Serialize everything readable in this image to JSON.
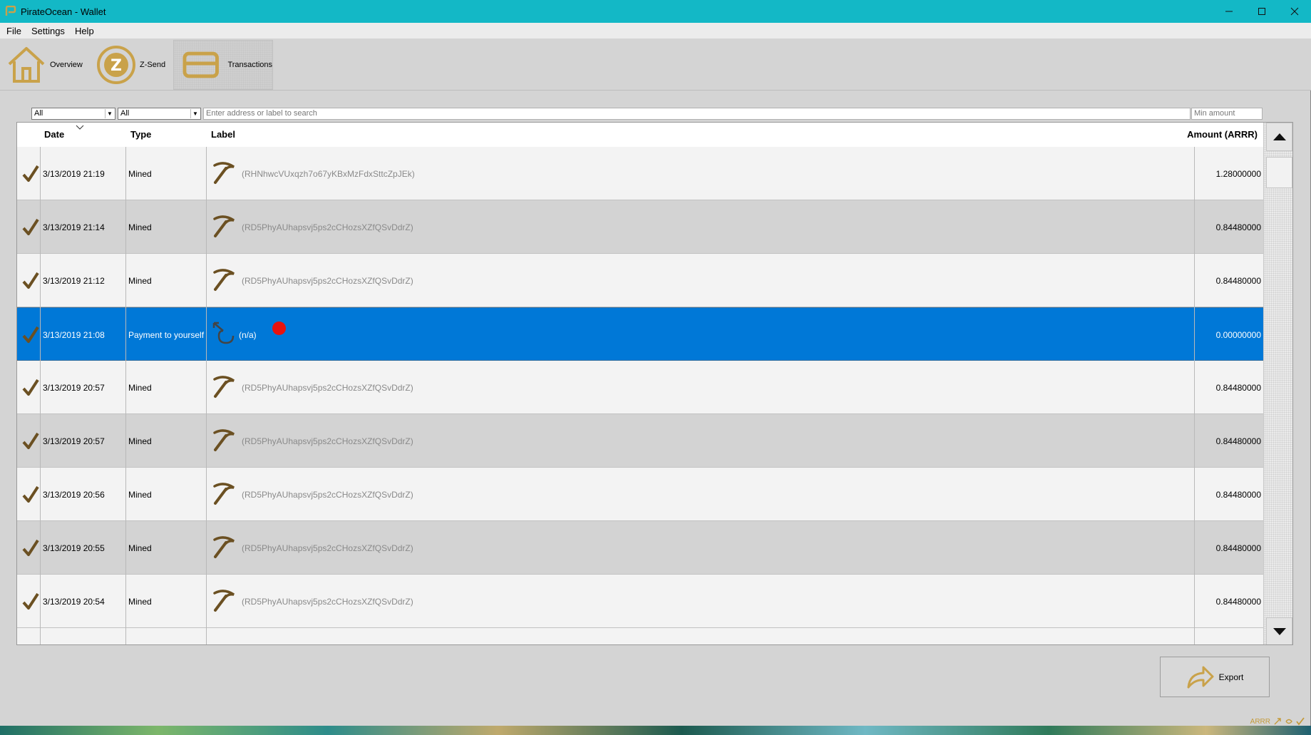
{
  "window": {
    "title": "PirateOcean - Wallet"
  },
  "menu": [
    "File",
    "Settings",
    "Help"
  ],
  "toolbar": {
    "overview": "Overview",
    "zsend": "Z-Send",
    "transactions": "Transactions"
  },
  "filters": {
    "date_filter": "All",
    "type_filter": "All",
    "search_placeholder": "Enter address or label to search",
    "min_amount_placeholder": "Min amount"
  },
  "table": {
    "headers": {
      "date": "Date",
      "type": "Type",
      "label": "Label",
      "amount": "Amount (ARRR)"
    },
    "rows": [
      {
        "date": "3/13/2019 21:19",
        "type": "Mined",
        "label": "(RHNhwcVUxqzh7o67yKBxMzFdxSttcZpJEk)",
        "amount": "1.28000000",
        "icon": "pickaxe-icon"
      },
      {
        "date": "3/13/2019 21:14",
        "type": "Mined",
        "label": "(RD5PhyAUhapsvj5ps2cCHozsXZfQSvDdrZ)",
        "amount": "0.84480000",
        "icon": "pickaxe-icon"
      },
      {
        "date": "3/13/2019 21:12",
        "type": "Mined",
        "label": "(RD5PhyAUhapsvj5ps2cCHozsXZfQSvDdrZ)",
        "amount": "0.84480000",
        "icon": "pickaxe-icon"
      },
      {
        "date": "3/13/2019 21:08",
        "type": "Payment to yourself",
        "label": "(n/a)",
        "amount": "0.00000000",
        "icon": "self-payment-icon"
      },
      {
        "date": "3/13/2019 20:57",
        "type": "Mined",
        "label": "(RD5PhyAUhapsvj5ps2cCHozsXZfQSvDdrZ)",
        "amount": "0.84480000",
        "icon": "pickaxe-icon"
      },
      {
        "date": "3/13/2019 20:57",
        "type": "Mined",
        "label": "(RD5PhyAUhapsvj5ps2cCHozsXZfQSvDdrZ)",
        "amount": "0.84480000",
        "icon": "pickaxe-icon"
      },
      {
        "date": "3/13/2019 20:56",
        "type": "Mined",
        "label": "(RD5PhyAUhapsvj5ps2cCHozsXZfQSvDdrZ)",
        "amount": "0.84480000",
        "icon": "pickaxe-icon"
      },
      {
        "date": "3/13/2019 20:55",
        "type": "Mined",
        "label": "(RD5PhyAUhapsvj5ps2cCHozsXZfQSvDdrZ)",
        "amount": "0.84480000",
        "icon": "pickaxe-icon"
      },
      {
        "date": "3/13/2019 20:54",
        "type": "Mined",
        "label": "(RD5PhyAUhapsvj5ps2cCHozsXZfQSvDdrZ)",
        "amount": "0.84480000",
        "icon": "pickaxe-icon"
      }
    ],
    "selected_row": 3
  },
  "export": {
    "label": "Export"
  },
  "status": {
    "unit": "ARRR"
  },
  "colors": {
    "titlebar": "#13b8c6",
    "accent_gold": "#c9a24a",
    "selection": "#0078d7",
    "icon_brown": "#6b5022"
  }
}
